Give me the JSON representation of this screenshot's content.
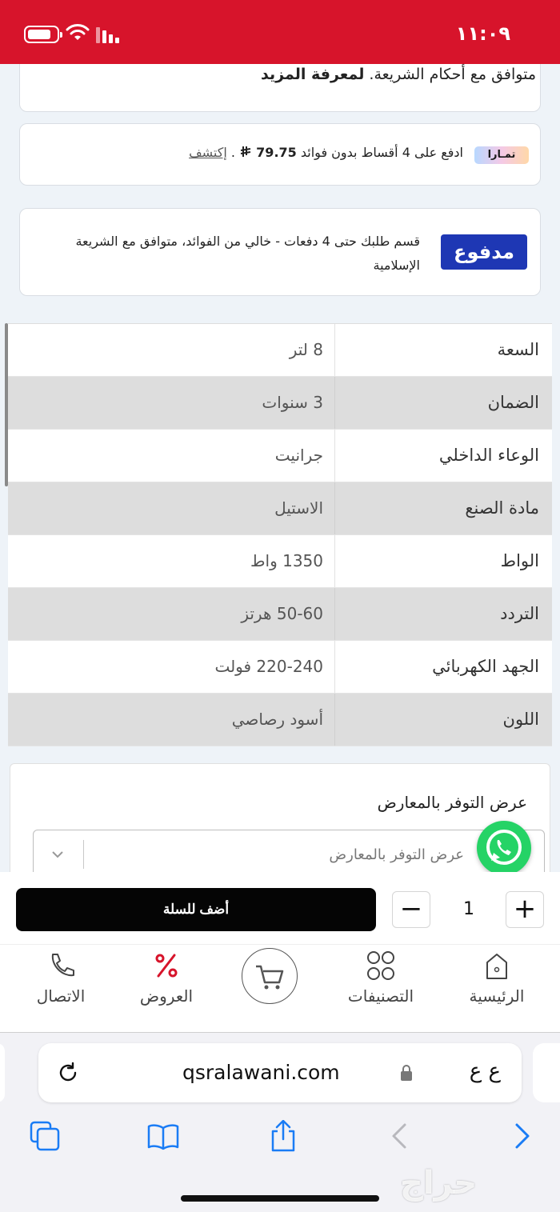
{
  "status_bar": {
    "time": "١١:٠٩"
  },
  "shariah_card": {
    "text": "متوافق مع أحكام الشريعة.",
    "link": "لمعرفة المزيد"
  },
  "tamara": {
    "logo": "تمـارا",
    "text_before": "ادفع على 4 أقساط بدون فوائد",
    "amount": "79.75",
    "text_after": ".",
    "discover": "إكتشف"
  },
  "madfu": {
    "logo": "مدفوع",
    "text": "قسم طلبك حتى 4 دفعات - خالي من الفوائد، متوافق مع الشريعة الإسلامية"
  },
  "specs": [
    {
      "label": "السعة",
      "value": "8 لتر"
    },
    {
      "label": "الضمان",
      "value": "3 سنوات"
    },
    {
      "label": "الوعاء الداخلي",
      "value": "جرانيت"
    },
    {
      "label": "مادة الصنع",
      "value": "الاستيل"
    },
    {
      "label": "الواط",
      "value": "1350 واط"
    },
    {
      "label": "التردد",
      "value": "50-60 هرتز"
    },
    {
      "label": "الجهد الكهربائي",
      "value": "220-240 فولت"
    },
    {
      "label": "اللون",
      "value": "أسود رصاصي"
    }
  ],
  "availability": {
    "title": "عرض التوفر بالمعارض",
    "placeholder": "عرض التوفر بالمعارض"
  },
  "cart": {
    "add_label": "أضف للسلة",
    "quantity": "1",
    "minus": "−",
    "plus": "+"
  },
  "nav": {
    "home": "الرئيسية",
    "categories": "التصنيفات",
    "offers": "العروض",
    "call": "الاتصال"
  },
  "browser": {
    "url": "qsralawani.com",
    "aa": "ع ع"
  },
  "watermark": "حراج",
  "colors": {
    "status_bar": "#d7142b",
    "madfu_blue": "#1e37b4",
    "whatsapp_green": "#25d366",
    "safari_blue": "#1a7cf5",
    "offers_red": "#d7142b"
  }
}
